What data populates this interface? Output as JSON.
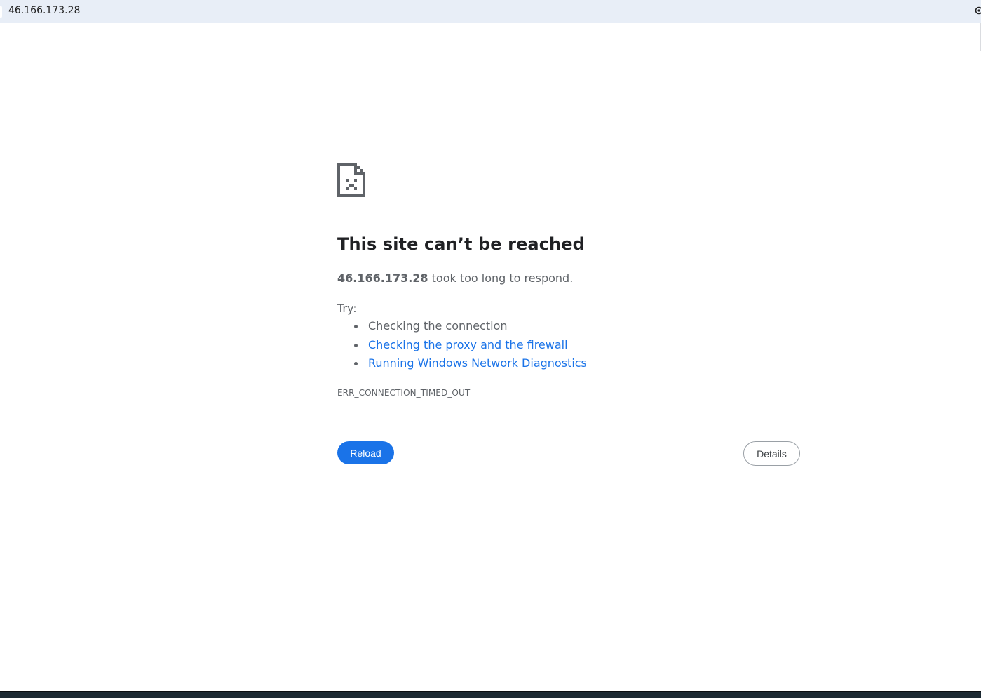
{
  "address_bar": {
    "url": "46.166.173.28"
  },
  "error_page": {
    "icon": "sad-page-icon",
    "title": "This site can’t be reached",
    "summary_host": "46.166.173.28",
    "summary_text": " took too long to respond.",
    "try_label": "Try:",
    "suggestions": [
      {
        "label": "Checking the connection",
        "is_link": false
      },
      {
        "label": "Checking the proxy and the firewall",
        "is_link": true
      },
      {
        "label": "Running Windows Network Diagnostics",
        "is_link": true
      }
    ],
    "error_code": "ERR_CONNECTION_TIMED_OUT",
    "reload_label": "Reload",
    "details_label": "Details"
  },
  "colors": {
    "accent": "#1a73e8",
    "text_primary": "#202124",
    "text_secondary": "#5f6368",
    "address_bar_bg": "#e8eef7"
  }
}
